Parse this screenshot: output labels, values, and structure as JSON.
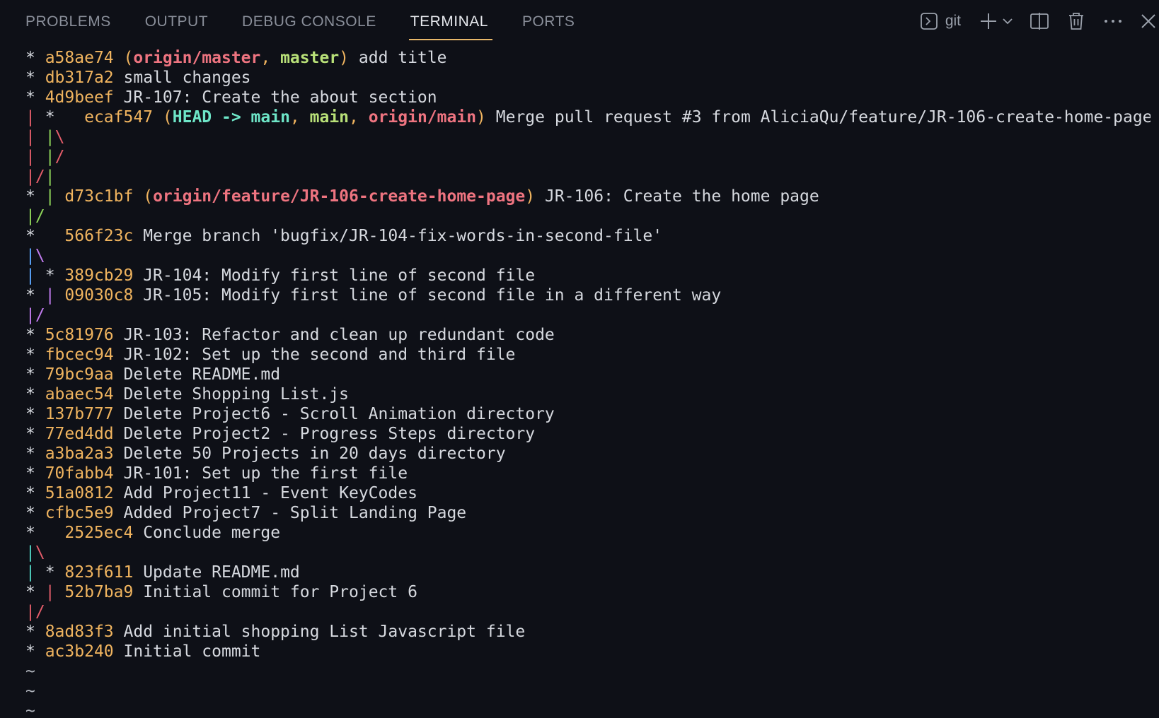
{
  "tabs": [
    {
      "label": "PROBLEMS",
      "active": false
    },
    {
      "label": "OUTPUT",
      "active": false
    },
    {
      "label": "DEBUG CONSOLE",
      "active": false
    },
    {
      "label": "TERMINAL",
      "active": true
    },
    {
      "label": "PORTS",
      "active": false
    }
  ],
  "actions": {
    "terminal_label": "git"
  },
  "colors": {
    "background": "#0e1017",
    "hash": "#f0b45f",
    "active_tab_underline": "#e8b86a",
    "graph_red": "#e45d6a",
    "graph_green": "#8fd65a",
    "graph_blue": "#5ba6ff",
    "graph_purple": "#c27cf0",
    "graph_teal": "#4fd2c0"
  },
  "log": [
    {
      "hash": "a58ae74",
      "refs": "(origin/master, master)",
      "msg": "add title"
    },
    {
      "hash": "db317a2",
      "msg": "small changes"
    },
    {
      "hash": "4d9beef",
      "msg": "JR-107: Create the about section"
    },
    {
      "hash": "ecaf547",
      "refs": "(HEAD -> main, origin/main)",
      "msg": "Merge pull request #3 from AliciaQu/feature/JR-106-create-home-page"
    },
    {
      "hash": "d73c1bf",
      "refs": "(origin/feature/JR-106-create-home-page)",
      "msg": "JR-106: Create the home page"
    },
    {
      "hash": "566f23c",
      "msg": "Merge branch 'bugfix/JR-104-fix-words-in-second-file'"
    },
    {
      "hash": "389cb29",
      "msg": "JR-104: Modify first line of second file"
    },
    {
      "hash": "09030c8",
      "msg": "JR-105: Modify first line of second file in a different way"
    },
    {
      "hash": "5c81976",
      "msg": "JR-103: Refactor and clean up redundant code"
    },
    {
      "hash": "fbcec94",
      "msg": "JR-102: Set up the second and third file"
    },
    {
      "hash": "79bc9aa",
      "msg": "Delete README.md"
    },
    {
      "hash": "abaec54",
      "msg": "Delete Shopping List.js"
    },
    {
      "hash": "137b777",
      "msg": "Delete Project6 - Scroll Animation directory"
    },
    {
      "hash": "77ed4dd",
      "msg": "Delete Project2 - Progress Steps directory"
    },
    {
      "hash": "a3ba2a3",
      "msg": "Delete 50 Projects in 20 days directory"
    },
    {
      "hash": "70fabb4",
      "msg": "JR-101: Set up the first file"
    },
    {
      "hash": "51a0812",
      "msg": "Add Project11 - Event KeyCodes"
    },
    {
      "hash": "cfbc5e9",
      "msg": "Added Project7 - Split Landing Page"
    },
    {
      "hash": "2525ec4",
      "msg": "Conclude merge"
    },
    {
      "hash": "823f611",
      "msg": "Update README.md"
    },
    {
      "hash": "52b7ba9",
      "msg": "Initial commit for Project 6"
    },
    {
      "hash": "8ad83f3",
      "msg": "Add initial shopping List Javascript file"
    },
    {
      "hash": "ac3b240",
      "msg": "Initial commit"
    }
  ],
  "refs_parts": {
    "c0": {
      "a": "origin/master",
      "b": "master"
    },
    "c3": {
      "head": "HEAD -> main",
      "b": "origin/main"
    },
    "c4": {
      "a": "origin/feature/JR-106-create-home-page"
    }
  }
}
